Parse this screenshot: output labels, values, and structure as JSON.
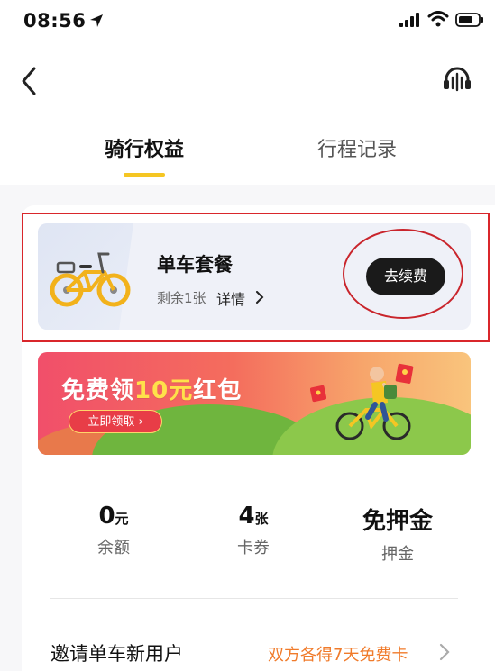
{
  "status_bar": {
    "time": "08:56"
  },
  "nav": {
    "back_icon": "chevron-left-icon",
    "service_icon": "headset-icon"
  },
  "tabs": [
    {
      "label": "骑行权益",
      "active": true
    },
    {
      "label": "行程记录",
      "active": false
    }
  ],
  "package": {
    "title": "单车套餐",
    "remaining": "剩余1张",
    "detail_label": "详情",
    "renew_label": "去续费"
  },
  "banner": {
    "title_prefix": "免费领",
    "title_highlight": "10元",
    "title_suffix": "红包",
    "button_label": "立即领取 ›"
  },
  "stats": [
    {
      "value": "0",
      "unit": "元",
      "label": "余额"
    },
    {
      "value": "4",
      "unit": "张",
      "label": "卡券"
    },
    {
      "value": "免押金",
      "unit": "",
      "label": "押金"
    }
  ],
  "invite": {
    "label": "邀请单车新用户",
    "reward": "双方各得7天免费卡"
  },
  "colors": {
    "accent_yellow": "#f5c623",
    "highlight_red": "#d9262b",
    "reward_orange": "#f07b2b",
    "button_dark": "#1a1a1a"
  }
}
